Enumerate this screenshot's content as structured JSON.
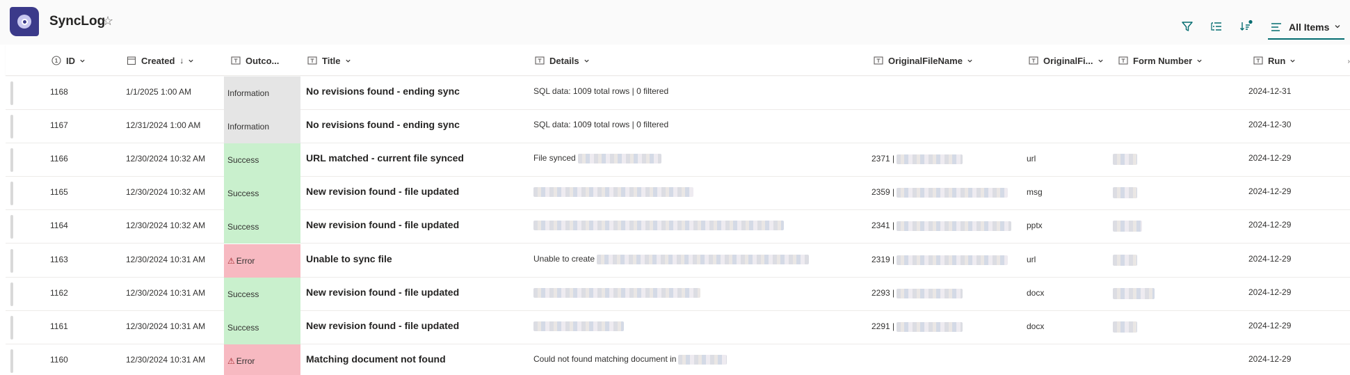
{
  "header": {
    "title": "SyncLog",
    "view_label": "All Items"
  },
  "colors": {
    "information_bg": "#e5e5e5",
    "success_bg": "#c9f0cd",
    "error_bg": "#f7b9c1",
    "accent": "#036c70"
  },
  "columns": {
    "id": "ID",
    "created": "Created",
    "created_sort": "↓",
    "outcome": "Outco...",
    "title": "Title",
    "details": "Details",
    "original_file_name": "OriginalFileName",
    "original_fi": "OriginalFi...",
    "form_number": "Form Number",
    "run": "Run"
  },
  "rows": [
    {
      "id": "1168",
      "created": "1/1/2025 1:00 AM",
      "outcome": "Information",
      "title": "No revisions found - ending sync",
      "details": "SQL data: 1009 total rows | 0 filtered",
      "ofn": "",
      "ext": "",
      "run": "2024-12-31"
    },
    {
      "id": "1167",
      "created": "12/31/2024 1:00 AM",
      "outcome": "Information",
      "title": "No revisions found - ending sync",
      "details": "SQL data: 1009 total rows | 0 filtered",
      "ofn": "",
      "ext": "",
      "run": "2024-12-30"
    },
    {
      "id": "1166",
      "created": "12/30/2024 10:32 AM",
      "outcome": "Success",
      "title": "URL matched - current file synced",
      "details": "File synced",
      "ofn": "2371 |",
      "ext": "url",
      "run": "2024-12-29"
    },
    {
      "id": "1165",
      "created": "12/30/2024 10:32 AM",
      "outcome": "Success",
      "title": "New revision found - file updated",
      "details": "",
      "ofn": "2359 |",
      "ext": "msg",
      "run": "2024-12-29"
    },
    {
      "id": "1164",
      "created": "12/30/2024 10:32 AM",
      "outcome": "Success",
      "title": "New revision found - file updated",
      "details": "",
      "ofn": "2341 |",
      "ext": "pptx",
      "run": "2024-12-29"
    },
    {
      "id": "1163",
      "created": "12/30/2024 10:31 AM",
      "outcome": "Error",
      "title": "Unable to sync file",
      "details": "Unable to create",
      "ofn": "2319 |",
      "ext": "url",
      "run": "2024-12-29"
    },
    {
      "id": "1162",
      "created": "12/30/2024 10:31 AM",
      "outcome": "Success",
      "title": "New revision found - file updated",
      "details": "",
      "ofn": "2293 |",
      "ext": "docx",
      "run": "2024-12-29"
    },
    {
      "id": "1161",
      "created": "12/30/2024 10:31 AM",
      "outcome": "Success",
      "title": "New revision found - file updated",
      "details": "",
      "ofn": "2291 |",
      "ext": "docx",
      "run": "2024-12-29"
    },
    {
      "id": "1160",
      "created": "12/30/2024 10:31 AM",
      "outcome": "Error",
      "title": "Matching document not found",
      "details": "Could not found matching document in",
      "ofn": "",
      "ext": "",
      "run": "2024-12-29"
    }
  ]
}
